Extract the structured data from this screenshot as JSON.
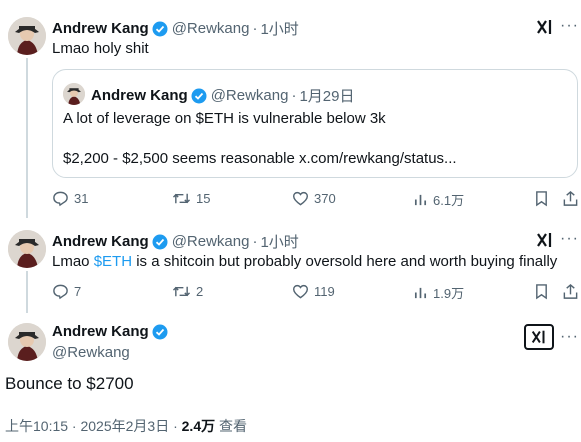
{
  "tweets": [
    {
      "name": "Andrew Kang",
      "handle": "@Rewkang",
      "sep": "·",
      "time": "1小时",
      "text": "Lmao holy shit",
      "quote": {
        "name": "Andrew Kang",
        "handle": "@Rewkang",
        "sep": "·",
        "time": "1月29日",
        "line1": "A lot of leverage on $ETH is vulnerable below 3k",
        "line2": "$2,200 - $2,500 seems reasonable x.com/rewkang/status..."
      },
      "actions": {
        "replies": "31",
        "reposts": "15",
        "likes": "370",
        "views": "6.1万"
      }
    },
    {
      "name": "Andrew Kang",
      "handle": "@Rewkang",
      "sep": "·",
      "time": "1小时",
      "text_before": "Lmao ",
      "cashtag": "$ETH",
      "text_after": " is a shitcoin but probably oversold here and worth buying finally",
      "actions": {
        "replies": "7",
        "reposts": "2",
        "likes": "119",
        "views": "1.9万"
      }
    }
  ],
  "main_tweet": {
    "name": "Andrew Kang",
    "handle": "@Rewkang",
    "text": "Bounce to $2700",
    "time_date": "上午10:15 · 2025年2月3日 · ",
    "views_count": "2.4万",
    "views_label": " 查看"
  },
  "colors": {
    "accent": "#1d9bf0",
    "muted": "#536471",
    "text": "#0f1419",
    "border": "#cfd9de"
  },
  "icons": [
    "verified-badge-icon",
    "grok-icon",
    "more-icon",
    "reply-icon",
    "repost-icon",
    "like-icon",
    "views-icon",
    "bookmark-icon",
    "share-icon"
  ]
}
